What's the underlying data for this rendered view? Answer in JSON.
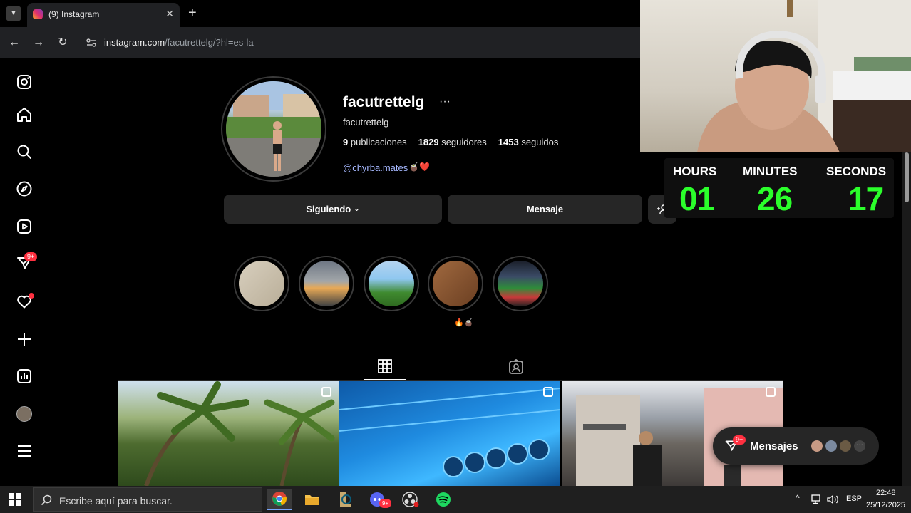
{
  "browser": {
    "tab_title": "(9) Instagram",
    "url_host": "instagram.com",
    "url_path": "/facutrettelg/?hl=es-la"
  },
  "sidebar": {
    "messages_badge": "9+"
  },
  "profile": {
    "username": "facutrettelg",
    "display_name": "facutrettelg",
    "posts_count": "9",
    "posts_label": "publicaciones",
    "followers_count": "1829",
    "followers_label": "seguidores",
    "following_count": "1453",
    "following_label": "seguidos",
    "bio_link": "@chyrba.mates",
    "bio_emoji": "🧉❤️"
  },
  "actions": {
    "following_label": "Siguiendo",
    "message_label": "Mensaje"
  },
  "highlights": {
    "label": "🔥🧉"
  },
  "messages_pill": {
    "label": "Mensajes",
    "badge": "9+"
  },
  "timer": {
    "hours_label": "HOURS",
    "minutes_label": "MINUTES",
    "seconds_label": "SECONDS",
    "hours": "01",
    "minutes": "26",
    "seconds": "17"
  },
  "taskbar": {
    "search_placeholder": "Escribe aquí para buscar.",
    "discord_badge": "9+",
    "language": "ESP",
    "time": "22:48",
    "date": "25/12/2025"
  }
}
